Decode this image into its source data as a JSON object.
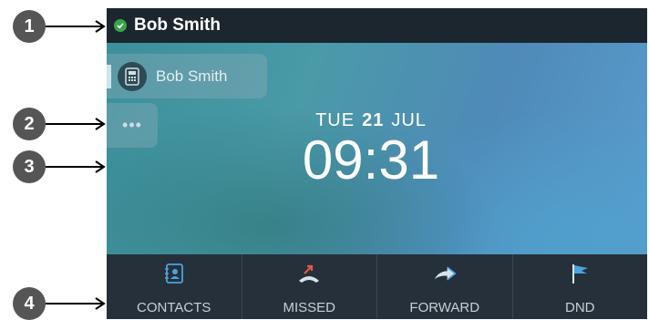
{
  "callouts": [
    "1",
    "2",
    "3",
    "4"
  ],
  "status": {
    "name": "Bob Smith",
    "presence": "available",
    "presence_color": "#3aa34a"
  },
  "line_key": {
    "label": "Bob Smith",
    "icon": "desk-phone-icon"
  },
  "more_key": {
    "label": "•••"
  },
  "datetime": {
    "weekday": "TUE",
    "day": "21",
    "month": "JUL",
    "time": "09:31"
  },
  "softkeys": [
    {
      "label": "CONTACTS",
      "icon": "contacts-book-icon"
    },
    {
      "label": "MISSED",
      "icon": "missed-call-icon"
    },
    {
      "label": "FORWARD",
      "icon": "forward-arrow-icon"
    },
    {
      "label": "DND",
      "icon": "flag-icon"
    }
  ],
  "colors": {
    "status_bar": "#1c262e",
    "softkey_bar": "#25303a",
    "accent": "#4aa3e0"
  }
}
